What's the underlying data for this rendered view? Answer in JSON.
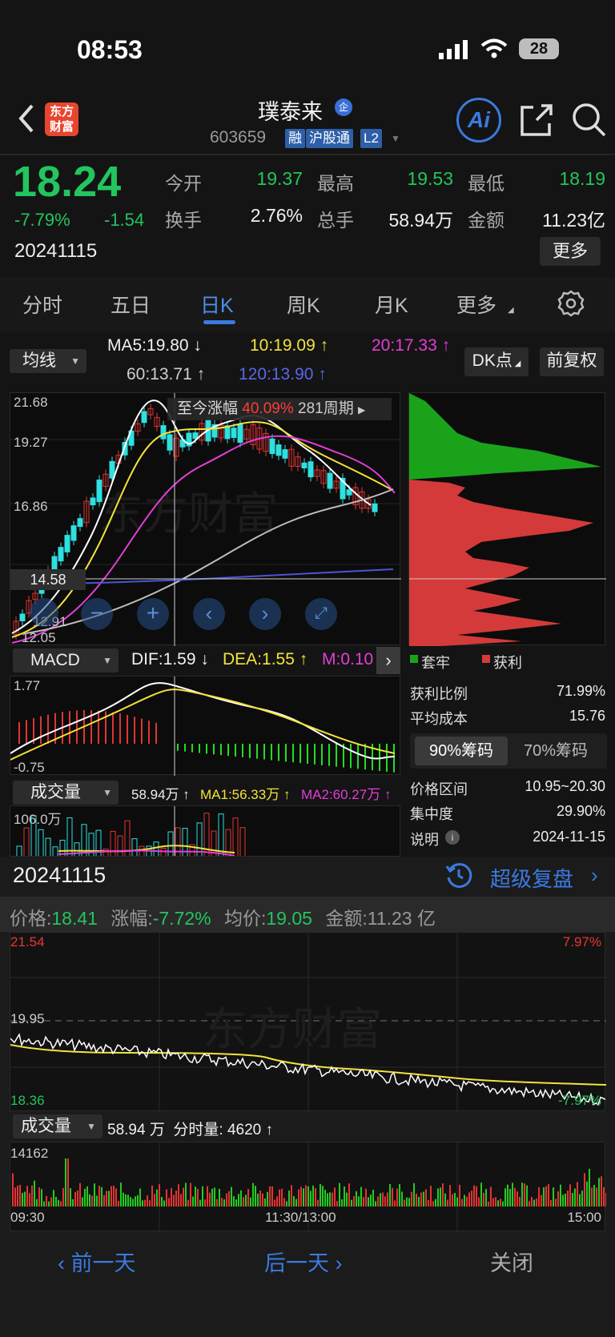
{
  "status": {
    "time": "08:53",
    "battery": "28"
  },
  "header": {
    "logo": "东方\n财富",
    "name": "璞泰来",
    "name_badge": "企",
    "code": "603659",
    "tags": [
      "融",
      "沪股通",
      "L2"
    ],
    "ai": "Ai"
  },
  "quote": {
    "price": "18.24",
    "change_pct": "-7.79%",
    "change": "-1.54",
    "date": "20241115",
    "open_label": "今开",
    "open": "19.37",
    "high_label": "最高",
    "high": "19.53",
    "low_label": "最低",
    "low": "18.19",
    "turnover_label": "换手",
    "turnover": "2.76%",
    "volume_label": "总手",
    "volume": "58.94万",
    "amount_label": "金额",
    "amount": "11.23亿",
    "more": "更多"
  },
  "tabs": [
    "分时",
    "五日",
    "日K",
    "周K",
    "月K",
    "更多"
  ],
  "indicators": {
    "ma_selector": "均线",
    "ma5": "MA5:19.80 ↓",
    "ma10": "10:19.09 ↑",
    "ma20": "20:17.33 ↑",
    "ma60": "60:13.71 ↑",
    "ma120": "120:13.90 ↑",
    "dk": "DK点",
    "adjust": "前复权"
  },
  "kchart": {
    "y_labels": [
      "21.68",
      "19.27",
      "16.86",
      "14.58",
      "12.91",
      "12.05"
    ],
    "crosshair_value": "14.58",
    "range_label": "至今涨幅",
    "range_value": "40.09%",
    "range_period": "281周期"
  },
  "macd": {
    "selector": "MACD",
    "dif": "DIF:1.59 ↓",
    "dea": "DEA:1.55 ↑",
    "m": "M:0.10",
    "y_top": "1.77",
    "y_bottom": "-0.75"
  },
  "volume": {
    "selector": "成交量",
    "vol": "58.94万 ↑",
    "ma1": "MA1:56.33万 ↑",
    "ma2": "MA2:60.27万 ↑",
    "y_top": "106.0万"
  },
  "chip": {
    "legend_trapped": "套牢",
    "legend_profit": "获利",
    "profit_ratio_label": "获利比例",
    "profit_ratio": "71.99%",
    "avg_cost_label": "平均成本",
    "avg_cost": "15.76",
    "tab90": "90%筹码",
    "tab70": "70%筹码",
    "range_label": "价格区间",
    "range": "10.95~20.30",
    "conc_label": "集中度",
    "conc": "29.90%",
    "note_label": "说明",
    "note": "2024-11-15"
  },
  "detail": {
    "date": "20241115",
    "replay": "超级复盘",
    "price_label": "价格:",
    "price": "18.41",
    "pct_label": "涨幅:",
    "pct": "-7.72%",
    "avg_label": "均价:",
    "avg": "19.05",
    "amt_label": "金额:",
    "amt": "11.23 亿",
    "y_top": "21.54",
    "y_mid": "19.95",
    "y_bottom": "18.36",
    "pct_top": "7.97%",
    "pct_bottom": "-7.97%",
    "vol_selector": "成交量",
    "vol_text": "58.94 万  分时量: 4620 ↑",
    "vol_max": "14162",
    "t_start": "09:30",
    "t_mid": "11:30/13:00",
    "t_end": "15:00"
  },
  "footer": {
    "prev": "‹ 前一天",
    "next": "后一天 ›",
    "close": "关闭"
  },
  "colors": {
    "up": "#e33333",
    "down": "#22c55e",
    "accent": "#3a7ae0",
    "ma5": "#ffffff",
    "ma10": "#f2e33a",
    "ma20": "#e33ed8",
    "ma60": "#bdbdbd",
    "ma120": "#4b55d6"
  }
}
